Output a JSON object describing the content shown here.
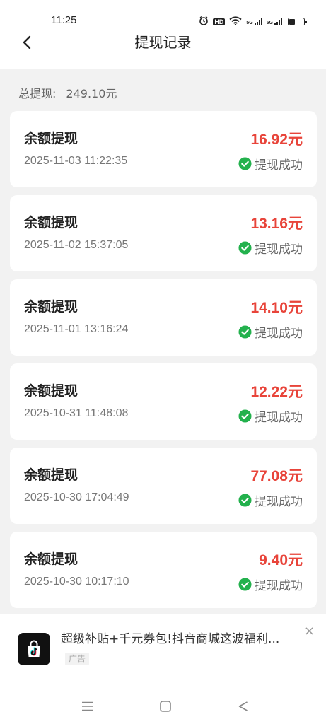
{
  "status_bar": {
    "time": "11:25",
    "hd_label": "HD",
    "signal_label": "5G"
  },
  "header": {
    "title": "提现记录"
  },
  "summary": {
    "label": "总提现:",
    "value": "249.10元"
  },
  "records": [
    {
      "title": "余额提现",
      "amount": "16.92元",
      "time": "2025-11-03 11:22:35",
      "status": "提现成功"
    },
    {
      "title": "余额提现",
      "amount": "13.16元",
      "time": "2025-11-02 15:37:05",
      "status": "提现成功"
    },
    {
      "title": "余额提现",
      "amount": "14.10元",
      "time": "2025-11-01 13:16:24",
      "status": "提现成功"
    },
    {
      "title": "余额提现",
      "amount": "12.22元",
      "time": "2025-10-31 11:48:08",
      "status": "提现成功"
    },
    {
      "title": "余额提现",
      "amount": "77.08元",
      "time": "2025-10-30 17:04:49",
      "status": "提现成功"
    },
    {
      "title": "余额提现",
      "amount": "9.40元",
      "time": "2025-10-30 10:17:10",
      "status": "提现成功"
    }
  ],
  "ad": {
    "text": "超级补贴+千元券包!抖音商城这波福利...",
    "tag": "广告",
    "close": "×"
  },
  "colors": {
    "amount": "#e8443a",
    "success": "#23b14d",
    "background": "#f2f2f2"
  },
  "icons": {
    "back": "chevron-left-icon",
    "alarm": "alarm-icon",
    "wifi": "wifi-icon",
    "signal": "signal-icon",
    "battery": "battery-icon",
    "check": "check-circle-icon",
    "ad_logo": "douyin-mall-icon",
    "menu": "menu-icon",
    "home": "home-icon",
    "back_nav": "back-triangle-icon"
  }
}
